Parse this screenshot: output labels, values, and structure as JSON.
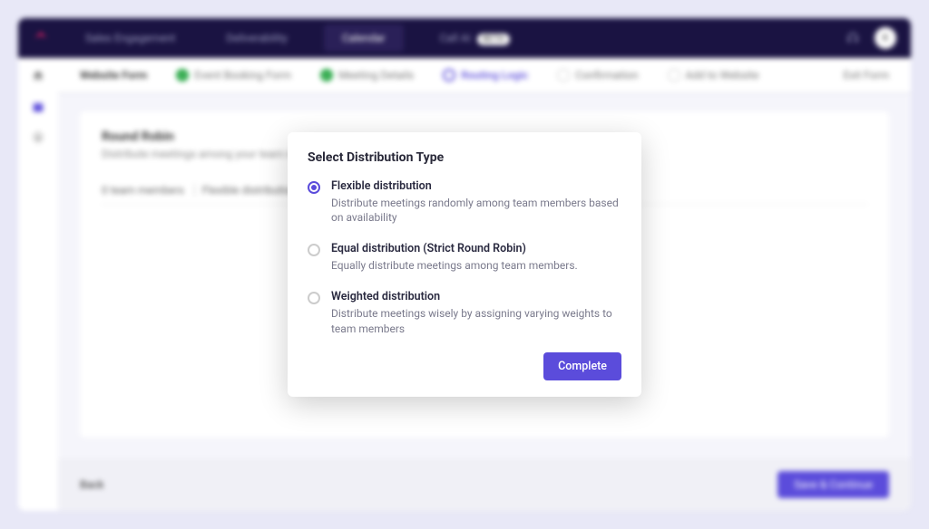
{
  "nav": {
    "items": [
      "Sales Engagement",
      "Deliverability",
      "Calendar",
      "Call AI"
    ],
    "badge": "BETA",
    "avatar_initial": "K"
  },
  "steps": {
    "title": "Website Form",
    "list": [
      {
        "label": "Event Booking Form",
        "state": "done"
      },
      {
        "label": "Meeting Details",
        "state": "done"
      },
      {
        "label": "Routing Logic",
        "state": "active"
      },
      {
        "label": "Confirmation",
        "state": "pending"
      },
      {
        "label": "Add to Website",
        "state": "pending"
      }
    ],
    "exit": "Exit Form"
  },
  "panel": {
    "title": "Round Robin",
    "subtitle": "Distribute meetings among your team members using Round Robin Assignment",
    "info_members": "0 team members",
    "info_dist": "Flexible distribution"
  },
  "footer": {
    "back": "Back",
    "save": "Save & Continue"
  },
  "modal": {
    "title": "Select Distribution Type",
    "options": [
      {
        "label": "Flexible distribution",
        "desc": "Distribute meetings randomly among team members based on availability",
        "selected": true
      },
      {
        "label": "Equal distribution (Strict Round Robin)",
        "desc": "Equally distribute meetings among team members.",
        "selected": false
      },
      {
        "label": "Weighted distribution",
        "desc": "Distribute meetings wisely by assigning varying weights to team members",
        "selected": false
      }
    ],
    "complete": "Complete"
  }
}
